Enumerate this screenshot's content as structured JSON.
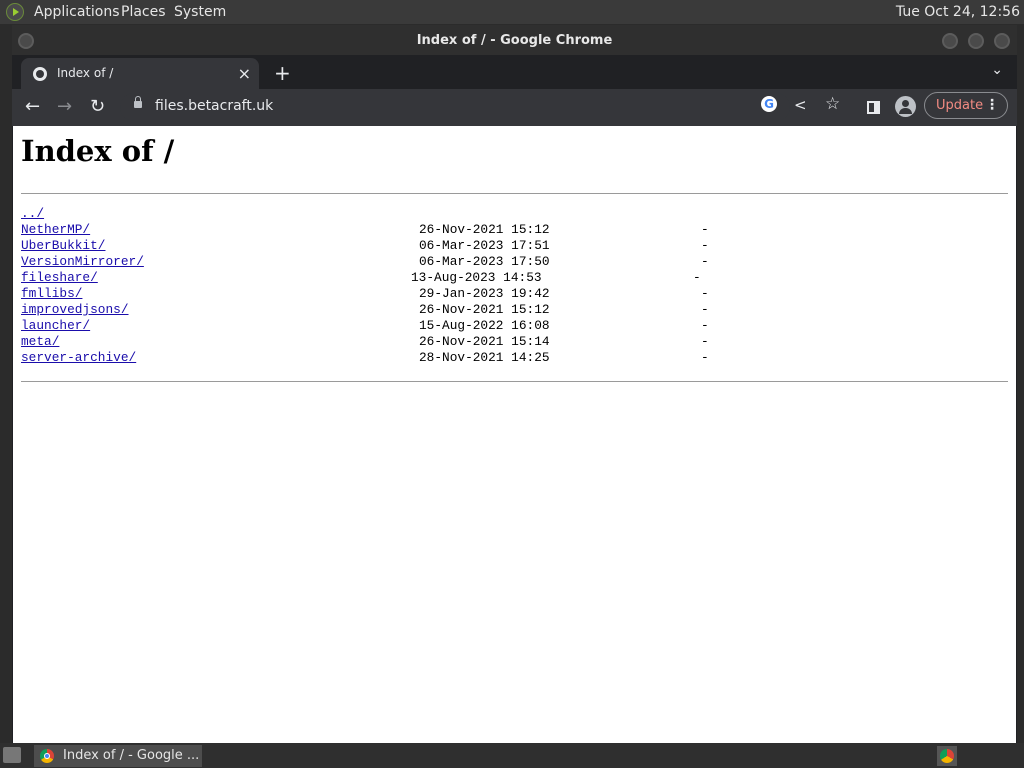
{
  "top_panel": {
    "menus": [
      "Applications",
      "Places",
      "System"
    ],
    "clock": "Tue Oct 24, 12:56"
  },
  "window": {
    "title": "Index of / - Google Chrome"
  },
  "tab": {
    "title": "Index of /",
    "close_glyph": "×",
    "new_tab_glyph": "+",
    "tab_list_glyph": "⌄"
  },
  "toolbar": {
    "back_glyph": "←",
    "forward_glyph": "→",
    "reload_glyph": "↻",
    "url": "files.betacraft.uk",
    "update_label": "Update",
    "menu_glyph": "⋮"
  },
  "page": {
    "heading": "Index of /",
    "parent_link": "../",
    "entries": [
      {
        "name": "NetherMP/",
        "date": "26-Nov-2021 15:12",
        "size": "-"
      },
      {
        "name": "UberBukkit/",
        "date": "06-Mar-2023 17:51",
        "size": "-"
      },
      {
        "name": "VersionMirrorer/",
        "date": "06-Mar-2023 17:50",
        "size": "-"
      },
      {
        "name": "fileshare/",
        "date": "13-Aug-2023 14:53",
        "size": "-"
      },
      {
        "name": "fmllibs/",
        "date": "29-Jan-2023 19:42",
        "size": "-"
      },
      {
        "name": "improvedjsons/",
        "date": "26-Nov-2021 15:12",
        "size": "-"
      },
      {
        "name": "launcher/",
        "date": "15-Aug-2022 16:08",
        "size": "-"
      },
      {
        "name": "meta/",
        "date": "26-Nov-2021 15:14",
        "size": "-"
      },
      {
        "name": "server-archive/",
        "date": "28-Nov-2021 14:25",
        "size": "-"
      }
    ]
  },
  "taskbar": {
    "item_label": "Index of / - Google ..."
  }
}
